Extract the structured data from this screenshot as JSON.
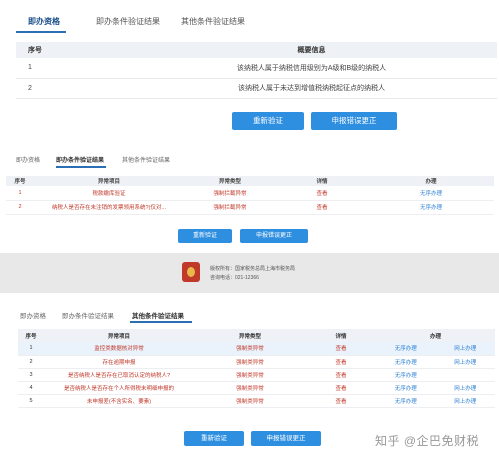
{
  "section1": {
    "tabs": [
      "即办资格",
      "即办条件验证结果",
      "其他条件验证结果"
    ],
    "table": {
      "headers": [
        "序号",
        "概要信息"
      ],
      "rows": [
        [
          "1",
          "该纳税人属于纳税信用级别为A级和B级的纳税人"
        ],
        [
          "2",
          "该纳税人属于未达到增值税纳税起征点的纳税人"
        ]
      ]
    },
    "buttons": {
      "revalidate": "重新验证",
      "report_error": "申报错误更正"
    }
  },
  "section2": {
    "tabs": [
      "即办资格",
      "即办条件验证结果",
      "其他条件验证结果"
    ],
    "table": {
      "headers": [
        "序号",
        "异常项目",
        "异常类型",
        "详情",
        "办理"
      ],
      "rows": [
        [
          "1",
          "税款缴库验证",
          "强制拦截异常",
          "查看",
          "无序办理"
        ],
        [
          "2",
          "纳税人是否存在未注销的发票领用系统?(仅对...",
          "强制拦截异常",
          "查看",
          "无序办理"
        ]
      ]
    },
    "buttons": {
      "revalidate": "重新验证",
      "report_error": "申报错误更正"
    }
  },
  "footer": {
    "sponsor": "版权所有：国家税务总局上海市税务局",
    "phone": "咨询电话：021-12366"
  },
  "section3": {
    "tabs": [
      "即办资格",
      "即办条件验证结果",
      "其他条件验证结果"
    ],
    "table": {
      "headers": [
        "序号",
        "异常项目",
        "异常类型",
        "详情",
        "办理"
      ],
      "rows": [
        [
          "1",
          "监控类数据核对异常",
          "强制类异常",
          "查看",
          "无序办理",
          "网上办理"
        ],
        [
          "2",
          "存在逾期申报",
          "强制类异常",
          "查看",
          "无序办理",
          "网上办理"
        ],
        [
          "3",
          "是否纳税人是否存在已取消认定的纳税人?",
          "强制类异常",
          "查看",
          "无序办理",
          ""
        ],
        [
          "4",
          "是否纳税人是否存在个人所得税未明细申报的",
          "强制类异常",
          "查看",
          "无序办理",
          "网上办理"
        ],
        [
          "5",
          "未申报差(不含实名、要素)",
          "强制类异常",
          "查看",
          "无序办理",
          "网上办理"
        ]
      ]
    },
    "buttons": {
      "revalidate": "重新验证",
      "report_error": "申报错误更正"
    }
  },
  "watermark": "知乎 @企巴免财税"
}
